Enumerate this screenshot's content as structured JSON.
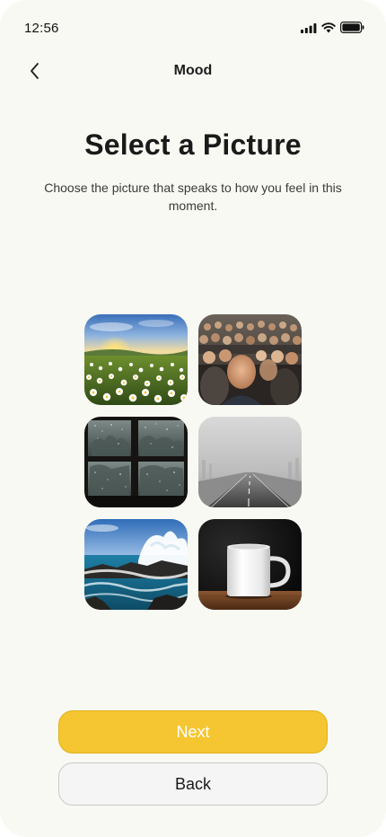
{
  "status_bar": {
    "time": "12:56",
    "icons": [
      "signal-icon",
      "wifi-icon",
      "battery-icon"
    ]
  },
  "header": {
    "title": "Mood",
    "back_icon": "chevron-left-icon"
  },
  "main": {
    "title": "Select a Picture",
    "subtitle": "Choose the picture that speaks to how you feel in this moment."
  },
  "pictures": [
    {
      "name": "picture-flower-meadow-sunrise"
    },
    {
      "name": "picture-blurry-crowd"
    },
    {
      "name": "picture-rainy-window"
    },
    {
      "name": "picture-foggy-road"
    },
    {
      "name": "picture-crashing-wave"
    },
    {
      "name": "picture-white-mug"
    }
  ],
  "actions": {
    "next_label": "Next",
    "back_label": "Back"
  },
  "colors": {
    "background": "#f9f9f3",
    "accent": "#f5c631",
    "secondary_button": "#f5f5f5"
  }
}
